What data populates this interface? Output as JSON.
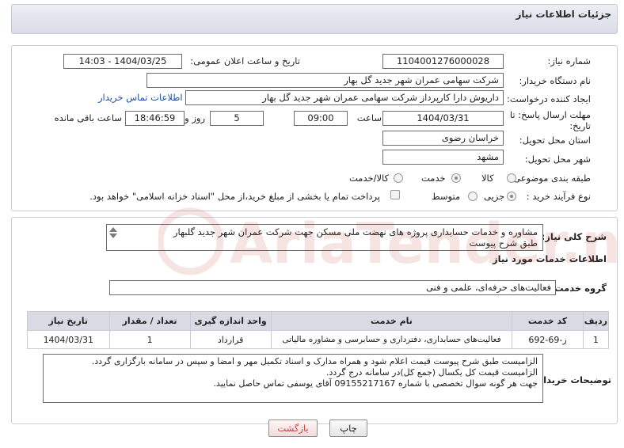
{
  "header": {
    "title": "جزئیات اطلاعات نیاز"
  },
  "form": {
    "need_number_label": "شماره نیاز:",
    "need_number": "1104001276000028",
    "announce_label": "تاریخ و ساعت اعلان عمومی:",
    "announce_value": "1404/03/25 - 14:03",
    "buyer_org_label": "نام دستگاه خریدار:",
    "buyer_org": "شرکت سهامی عمران شهر جدید گل بهار",
    "creator_label": "ایجاد کننده درخواست:",
    "creator": "داریوش دارا کارپرداز شرکت سهامی عمران شهر جدید گل بهار",
    "buyer_contact_link": "اطلاعات تماس خریدار",
    "deadline_label_line1": "مهلت ارسال پاسخ: تا",
    "deadline_label_line2": "تاریخ:",
    "deadline_date": "1404/03/31",
    "time_label": "ساعت",
    "deadline_time": "09:00",
    "days_value": "5",
    "days_label": "روز و",
    "remaining_time": "18:46:59",
    "remaining_label": "ساعت باقی مانده",
    "province_label": "استان محل تحویل:",
    "province": "خراسان رضوی",
    "city_label": "شهر محل تحویل:",
    "city": "مشهد",
    "category_label": "طبقه بندی موضوعی:",
    "category_options": [
      "کالا",
      "خدمت",
      "کالا/خدمت"
    ],
    "category_selected": "خدمت",
    "process_label": "نوع فرآیند خرید :",
    "process_options": [
      "جزیی",
      "متوسط"
    ],
    "process_selected": "جزیی",
    "payment_note": "پرداخت تمام یا بخشی از مبلغ خرید،از محل \"اسناد خزانه اسلامی\" خواهد بود."
  },
  "summary": {
    "label": "شرح کلی نیاز:",
    "line1": "مشاوره و خدمات حسابداری پروژه های نهضت ملی مسکن جهت شرکت عمران شهر جدید گلبهار",
    "line2": "طبق شرح پیوست"
  },
  "services": {
    "section_title": "اطلاعات خدمات مورد نیاز",
    "group_label": "گروه خدمت:",
    "group_value": "فعالیت‌های حرفه‌ای، علمی و فنی",
    "columns": [
      "ردیف",
      "کد خدمت",
      "نام خدمت",
      "واحد اندازه گیری",
      "تعداد / مقدار",
      "تاریخ نیاز"
    ],
    "rows": [
      [
        "1",
        "ز-69-692",
        "فعالیت‌های حسابداری، دفترداری و حسابرسی و مشاوره مالیاتی",
        "قرارداد",
        "1",
        "1404/03/31"
      ]
    ]
  },
  "buyer_notes": {
    "label": "توضیحات خریدار:",
    "line1": "الزامیست طبق شرح پیوست قیمت اعلام شود و همراه مدارک و اسناد تکمیل مهر و امضا و سپس در سامانه بارگزاری گردد.",
    "line2": "الزامیست قیمت کل یکسال (جمع کل)در سامانه درج گردد.",
    "line3": "جهت هر گونه سوال تخصصی با شماره 09155217167 آقای یوسفی تماس حاصل نمایید."
  },
  "buttons": {
    "print": "چاپ",
    "back": "بازگشت"
  },
  "watermark": {
    "text": "AriaTender.neT"
  },
  "colors": {
    "link": "#1f4fa3",
    "header_bg": "#dde0e8",
    "back_button_text": "#d04040",
    "watermark": "#c0392b"
  }
}
